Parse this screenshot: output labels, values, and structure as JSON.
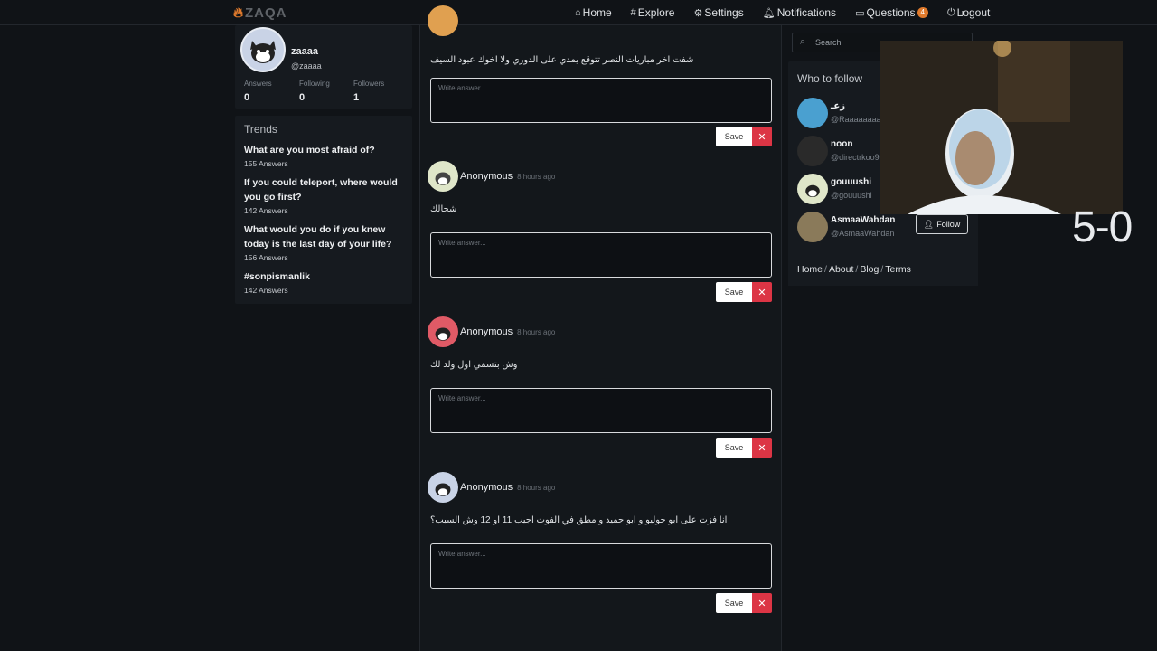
{
  "nav": {
    "logo": "ZAQA",
    "links": [
      {
        "icon": "home-icon",
        "glyph": "⌂",
        "label": "Home"
      },
      {
        "icon": "hash-icon",
        "glyph": "#",
        "label": "Explore"
      },
      {
        "icon": "gear-icon",
        "glyph": "⚙",
        "label": "Settings"
      },
      {
        "icon": "bell-icon",
        "glyph": "🔔︎",
        "label": "Notifications"
      },
      {
        "icon": "chat-icon",
        "glyph": "▭",
        "label": "Questions",
        "badge": "4"
      },
      {
        "icon": "logout-icon",
        "glyph": "⏻",
        "label": "Logout"
      }
    ],
    "theme_glyph": "◑"
  },
  "profile": {
    "name": "zaaaa",
    "handle": "@zaaaa",
    "stats": [
      {
        "label": "Answers",
        "value": "0"
      },
      {
        "label": "Following",
        "value": "0"
      },
      {
        "label": "Followers",
        "value": "1"
      }
    ]
  },
  "trends": {
    "title": "Trends",
    "items": [
      {
        "question": "What are you most afraid of?",
        "count": "155 Answers"
      },
      {
        "question": "If you could teleport, where would you go first?",
        "count": "142 Answers"
      },
      {
        "question": "What would you do if you knew today is the last day of your life?",
        "count": "156 Answers"
      },
      {
        "question": "#sonpismanlik",
        "count": "142 Answers"
      }
    ]
  },
  "feed": {
    "answer_placeholder": "Write answer...",
    "save_label": "Save",
    "delete_glyph": "✕",
    "questions": [
      {
        "author": "",
        "time": "",
        "text": "شفت اخر مباريات النصر تتوقع يمدي على الدوري ولا اخوك عبود السيف",
        "avatar_color": "#e0a050"
      },
      {
        "author": "Anonymous",
        "time": "8 hours ago",
        "text": "شحالك",
        "avatar_color": "#dfe6c9"
      },
      {
        "author": "Anonymous",
        "time": "8 hours ago",
        "text": "وش بتسمي اول ولد لك",
        "avatar_color": "#e05a66"
      },
      {
        "author": "Anonymous",
        "time": "8 hours ago",
        "text": "انا فزت على ابو جوليو و ابو حميد و مطق في الفوت اجيب 11 او 12 وش السبب؟",
        "avatar_color": "#c9d3e6"
      }
    ]
  },
  "sidebar_right": {
    "search_placeholder": "Search",
    "who_to_follow_title": "Who to follow",
    "users": [
      {
        "name": "زعـ",
        "handle": "@Raaaaaaaa3",
        "avatar_color": "#4aa0d0"
      },
      {
        "name": "noon",
        "handle": "@directrkoo97",
        "avatar_color": "#2a2a2a"
      },
      {
        "name": "gouuushi",
        "handle": "@gouuushi",
        "avatar_color": "#dfe6c9"
      },
      {
        "name": "AsmaaWahdan",
        "handle": "@AsmaaWahdan",
        "avatar_color": "#8a7a5a",
        "follow_label": "Follow"
      }
    ],
    "footer": [
      "Home",
      "About",
      "Blog",
      "Terms"
    ]
  },
  "overlay": {
    "score": "5-0"
  }
}
